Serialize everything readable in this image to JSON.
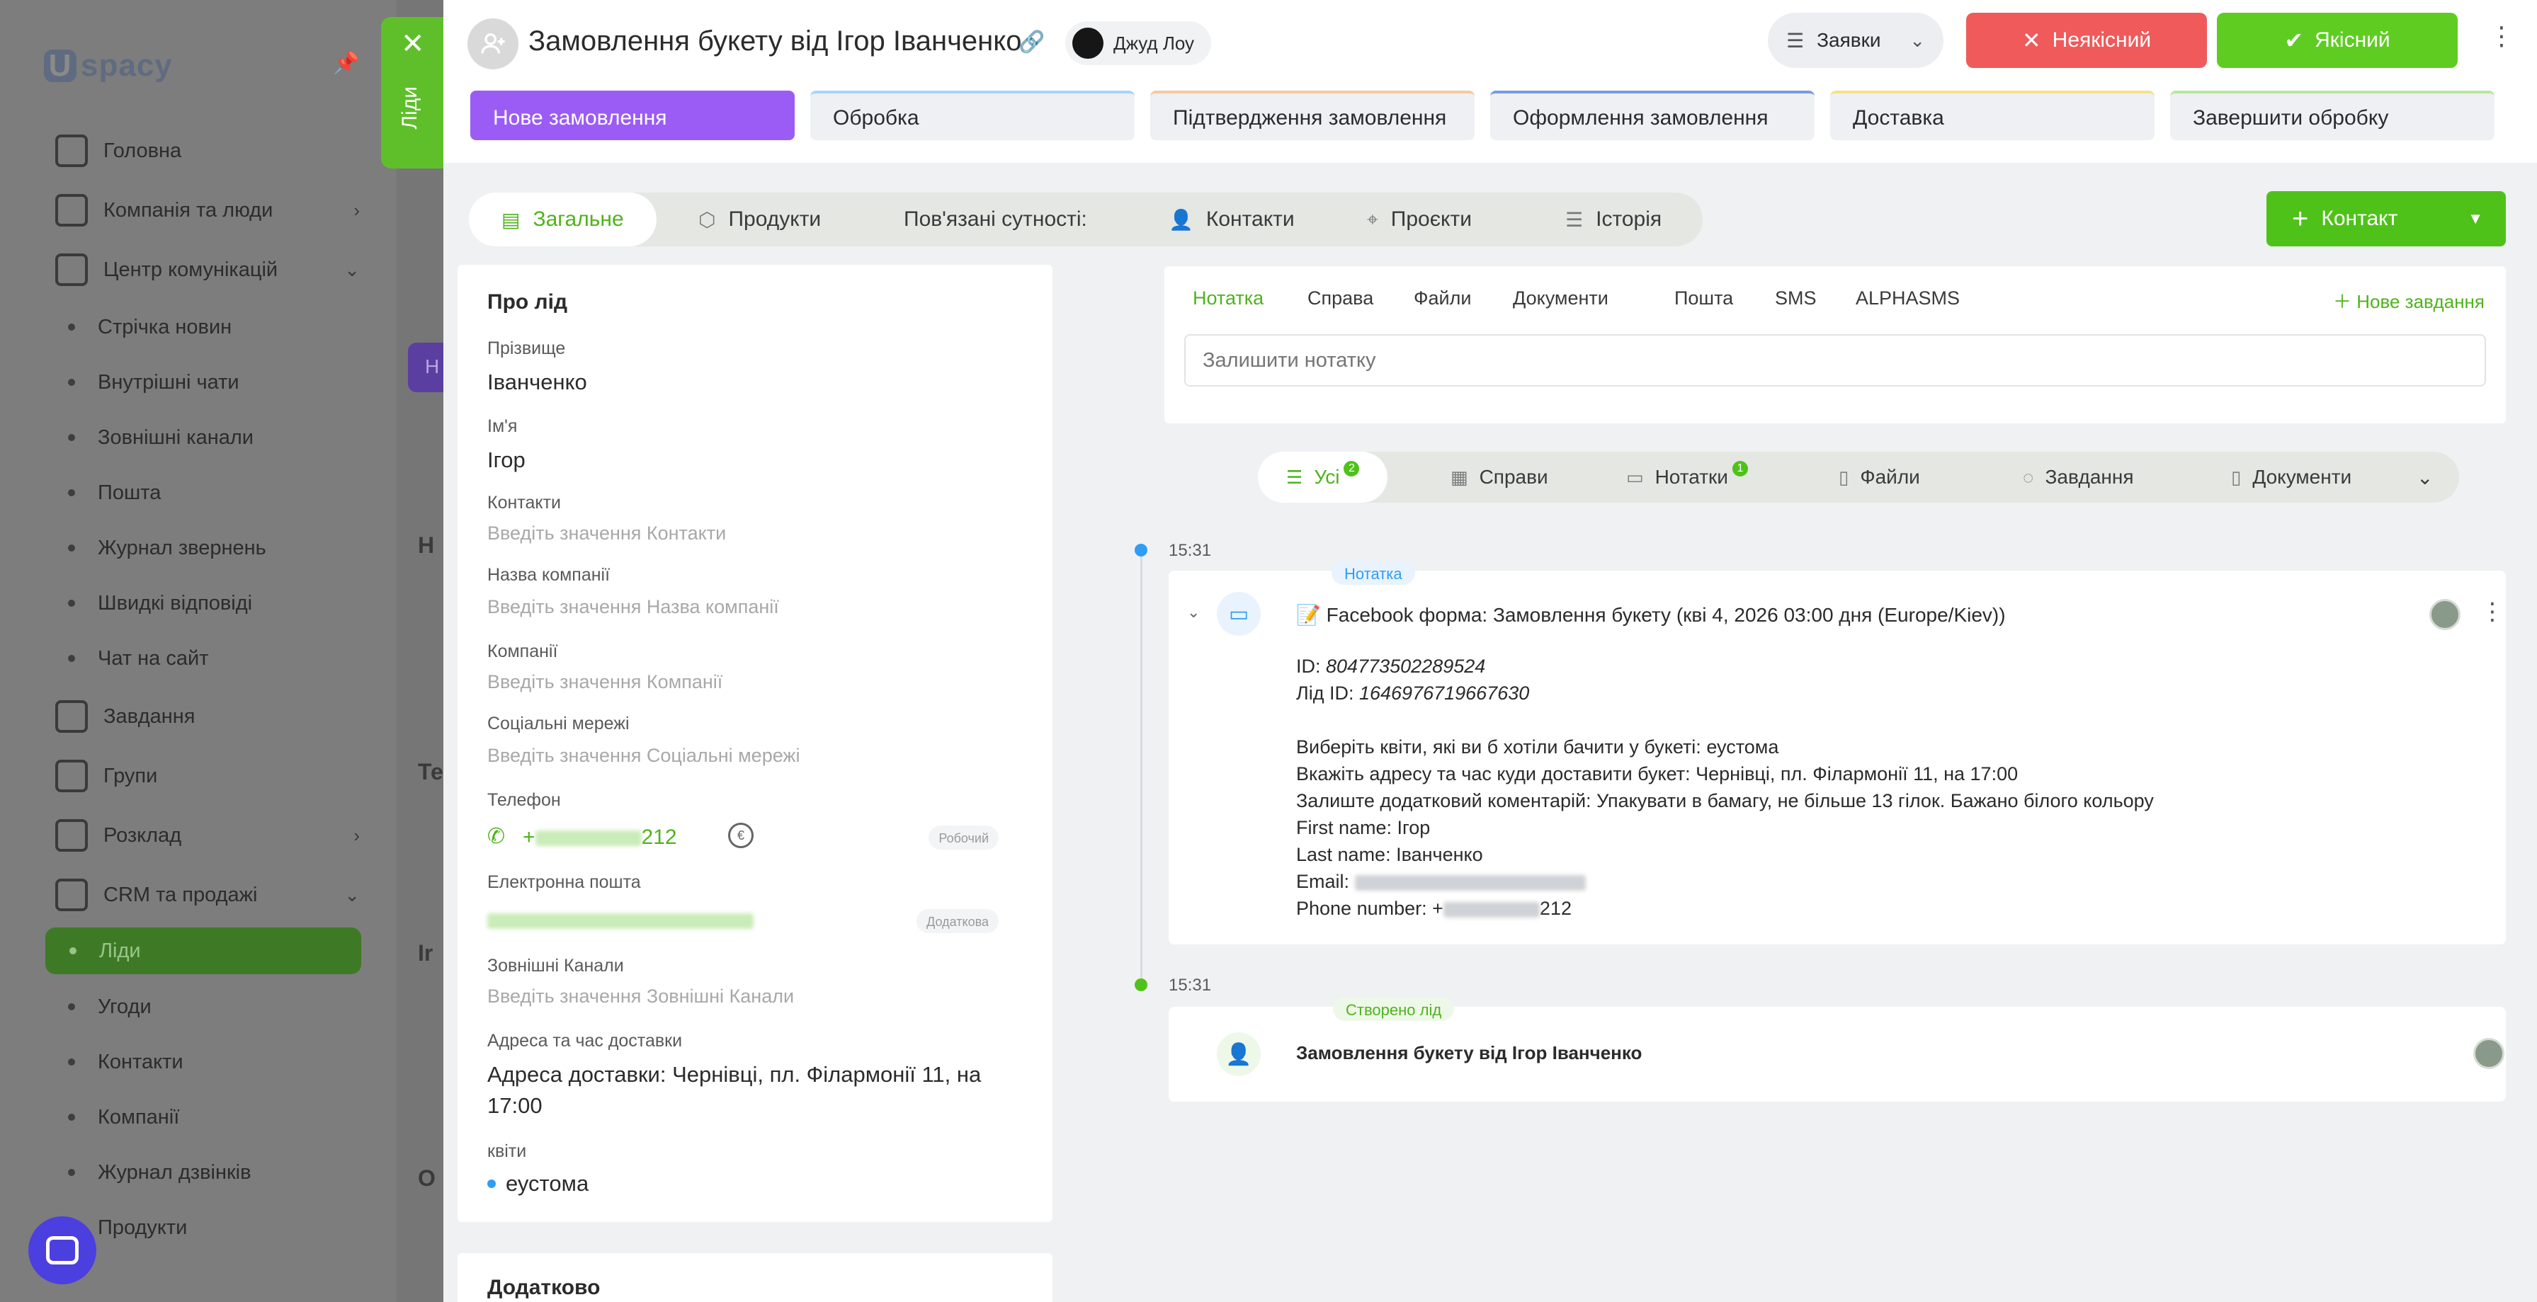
{
  "bg": {
    "logo": "spacy",
    "nav": {
      "home": "Головна",
      "companies_people": "Компанія та люди",
      "comm_center": "Центр комунікацій",
      "news": "Стрічка новин",
      "internal_chats": "Внутрішні чати",
      "external_channels": "Зовнішні канали",
      "mail": "Пошта",
      "requests_log": "Журнал звернень",
      "quick_replies": "Швидкі відповіді",
      "site_chat": "Чат на сайт",
      "tasks": "Завдання",
      "groups": "Групи",
      "schedule": "Розклад",
      "crm_sales": "CRM та продажі",
      "leads": "Ліди",
      "deals": "Угоди",
      "contacts": "Контакти",
      "companies": "Компанії",
      "call_log": "Журнал дзвінків",
      "products": "Продукти"
    }
  },
  "side_tab": {
    "label": "Ліди",
    "close": "✕"
  },
  "header": {
    "title": "Замовлення букету від Ігор Іванченко",
    "owner": "Джуд Лоу",
    "pipeline": "Заявки",
    "btn_bad": "Неякісний",
    "btn_good": "Якісний"
  },
  "stages": [
    {
      "label": "Нове замовлення",
      "color": "#9b5cf6"
    },
    {
      "label": "Обробка",
      "color": "#a9d4f5"
    },
    {
      "label": "Підтвердження замовлення",
      "color": "#f4c9a0"
    },
    {
      "label": "Оформлення замовлення",
      "color": "#7a9be0"
    },
    {
      "label": "Доставка",
      "color": "#f7e08a"
    },
    {
      "label": "Завершити обробку",
      "color": "#b9e6a0"
    }
  ],
  "tabs": {
    "general": "Загальне",
    "products": "Продукти",
    "related": "Пов'язані сутності:",
    "contacts": "Контакти",
    "projects": "Проєкти",
    "history": "Історія"
  },
  "contact_button": "Контакт",
  "about": {
    "title": "Про лід",
    "surname_label": "Прізвище",
    "surname": "Іванченко",
    "name_label": "Ім'я",
    "name": "Ігор",
    "contacts_label": "Контакти",
    "contacts_ph": "Введіть значення Контакти",
    "company_name_label": "Назва компанії",
    "company_name_ph": "Введіть значення Назва компанії",
    "companies_label": "Компанії",
    "companies_ph": "Введіть значення Компанії",
    "social_label": "Соціальні мережі",
    "social_ph": "Введіть значення Соціальні мережі",
    "phone_label": "Телефон",
    "phone_prefix": "+",
    "phone_suffix": "212",
    "phone_type": "Робочий",
    "email_label": "Електронна пошта",
    "email_type": "Додаткова",
    "ext_channels_label": "Зовнішні Канали",
    "ext_channels_ph": "Введіть значення Зовнішні Канали",
    "address_label": "Адреса та час доставки",
    "address_line1": "Адреса доставки: Чернівці, пл. Філармонії 11, на",
    "address_line2": "17:00",
    "flowers_label": "квіти",
    "flowers": "еустома"
  },
  "extra_title": "Додатково",
  "composer": {
    "tabs": [
      "Нотатка",
      "Справа",
      "Файли",
      "Документи",
      "Пошта",
      "SMS",
      "ALPHASMS"
    ],
    "new_task": "Нове завдання",
    "placeholder": "Залишити нотатку"
  },
  "filters": {
    "all": "Усі",
    "all_count": "2",
    "cases": "Справи",
    "notes": "Нотатки",
    "notes_count": "1",
    "files": "Файли",
    "tasks": "Завдання",
    "documents": "Документи"
  },
  "timeline": {
    "e1_time": "15:31",
    "e1_tag": "Нотатка",
    "e1_title": "📝 Facebook форма: Замовлення букету (кві 4, 2026 03:00 дня (Europe/Kiev))",
    "e1_id": "ID: ",
    "e1_id_val": "804773502289524",
    "e1_lead_id": "Лід ID: ",
    "e1_lead_id_val": "1646976719667630",
    "e1_q1": "Виберіть квіти, які ви б хотіли бачити у букеті: еустома",
    "e1_q2": "Вкажіть адресу та час куди доставити букет: Чернівці, пл. Філармонії 11, на 17:00",
    "e1_q3": "Залиште додатковий коментарій: Упакувати в бамагу, не більше 13 гілок. Бажано білого кольору",
    "e1_first": "First name: Ігор",
    "e1_last": "Last name: Іванченко",
    "e1_email": "Email: ",
    "e1_phone": "Phone number: +",
    "e1_phone_suffix": "212",
    "e2_time": "15:31",
    "e2_tag": "Створено лід",
    "e2_title": "Замовлення букету від Ігор Іванченко"
  }
}
